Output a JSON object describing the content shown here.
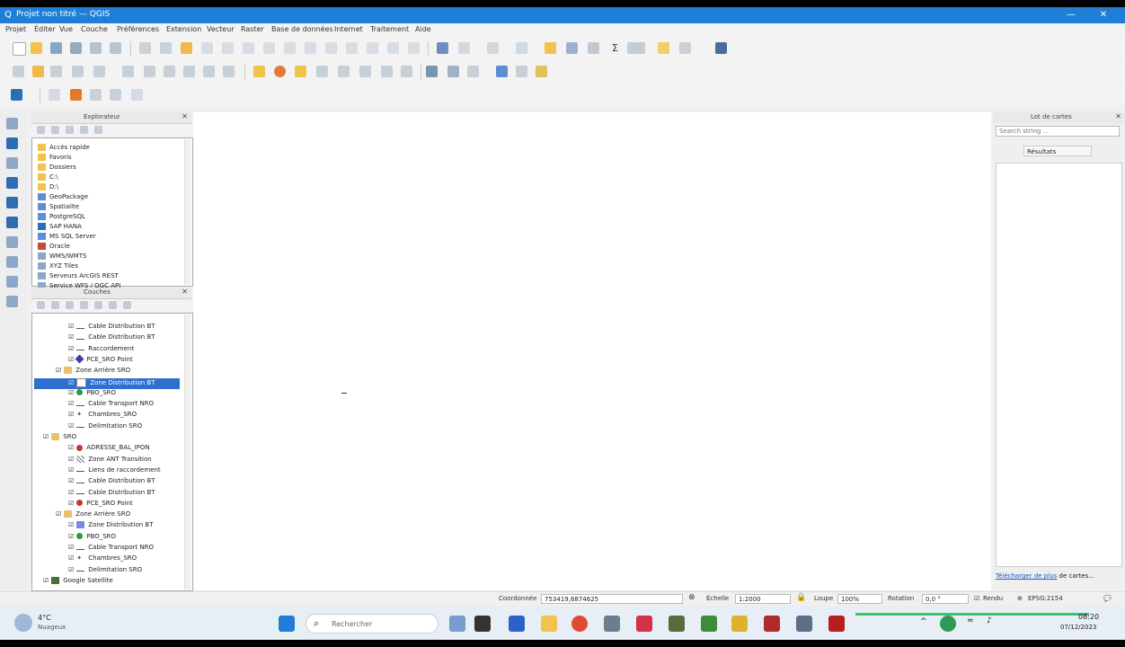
{
  "window": {
    "title": "Projet non titré — QGIS",
    "minimize_label": "—",
    "maximize_label": "□",
    "close_label": "✕"
  },
  "menu": [
    "Projet",
    "Éditer",
    "Vue",
    "Couche",
    "Préférences",
    "Extension",
    "Vecteur",
    "Raster",
    "Base de données",
    "Internet",
    "Traitement",
    "Aide"
  ],
  "browser_panel": {
    "title": "Explorateur",
    "items": [
      "Accès rapide",
      "Favoris",
      "Dossiers",
      "C:\\",
      "D:\\",
      "GeoPackage",
      "Spatialite",
      "PostgreSQL",
      "SAP HANA",
      "MS SQL Server",
      "Oracle",
      "WMS/WMTS",
      "XYZ Tiles",
      "Serveurs ArcGIS REST",
      "Service WFS / OGC API"
    ]
  },
  "layers_panel": {
    "title": "Couches",
    "items": [
      {
        "label": "Cable Distribution BT",
        "indent": 2,
        "icon": "line"
      },
      {
        "label": "Cable Distribution BT",
        "indent": 2,
        "icon": "line"
      },
      {
        "label": "Raccordement",
        "indent": 2,
        "icon": "line"
      },
      {
        "label": "PCE_SRO Point",
        "indent": 2,
        "icon": "diamond"
      },
      {
        "label": "Zone Arrière SRO",
        "indent": 1,
        "icon": "group"
      },
      {
        "label": "Zone Distribution BT",
        "indent": 2,
        "icon": "poly",
        "selected": true
      },
      {
        "label": "PBO_SRO",
        "indent": 2,
        "icon": "dot-green"
      },
      {
        "label": "Cable Transport NRO",
        "indent": 2,
        "icon": "line"
      },
      {
        "label": "Chambres_SRO",
        "indent": 2,
        "icon": "star"
      },
      {
        "label": "Delimitation SRO",
        "indent": 2,
        "icon": "line"
      },
      {
        "label": "SRO",
        "indent": 0,
        "icon": "group"
      },
      {
        "label": "ADRESSE_BAL_IPON",
        "indent": 2,
        "icon": "dot-red"
      },
      {
        "label": "Zone ANT Transition",
        "indent": 2,
        "icon": "poly-hatch"
      },
      {
        "label": "Liens de raccordement",
        "indent": 2,
        "icon": "line"
      },
      {
        "label": "Cable Distribution BT",
        "indent": 2,
        "icon": "line"
      },
      {
        "label": "Cable Distribution BT",
        "indent": 2,
        "icon": "line"
      },
      {
        "label": "PCE_SRO Point",
        "indent": 2,
        "icon": "dot-red"
      },
      {
        "label": "Zone Arrière SRO",
        "indent": 1,
        "icon": "group"
      },
      {
        "label": "Zone Distribution BT",
        "indent": 2,
        "icon": "poly-blue"
      },
      {
        "label": "PBO_SRO",
        "indent": 2,
        "icon": "dot-green"
      },
      {
        "label": "Cable Transport NRO",
        "indent": 2,
        "icon": "line"
      },
      {
        "label": "Chambres_SRO",
        "indent": 2,
        "icon": "star"
      },
      {
        "label": "Delimitation SRO",
        "indent": 2,
        "icon": "line"
      },
      {
        "label": "Google Satellite",
        "indent": 0,
        "icon": "raster"
      }
    ]
  },
  "right_panel": {
    "title": "Lot de cartes",
    "search_placeholder": "Search string ...",
    "tab_label": "Résultats",
    "footer_link": "Télécharger de plus",
    "footer_text": "de cartes..."
  },
  "status": {
    "coord_label": "Coordonnée",
    "coord_value": "753419,6874625",
    "scale_label": "Échelle",
    "scale_value": "1:2000",
    "magnifier_label": "Loupe",
    "magnifier_value": "100%",
    "rotation_label": "Rotation",
    "rotation_value": "0,0 °",
    "render_label": "Rendu",
    "crs_label": "EPSG:2154"
  },
  "taskbar": {
    "weather_temp": "4°C",
    "weather_text": "Nuageux",
    "search_placeholder": "Rechercher",
    "time": "08:20",
    "date": "07/12/2023"
  },
  "colors": {
    "titlebar": "#1f7fd6",
    "selection": "#2e6fd0"
  }
}
